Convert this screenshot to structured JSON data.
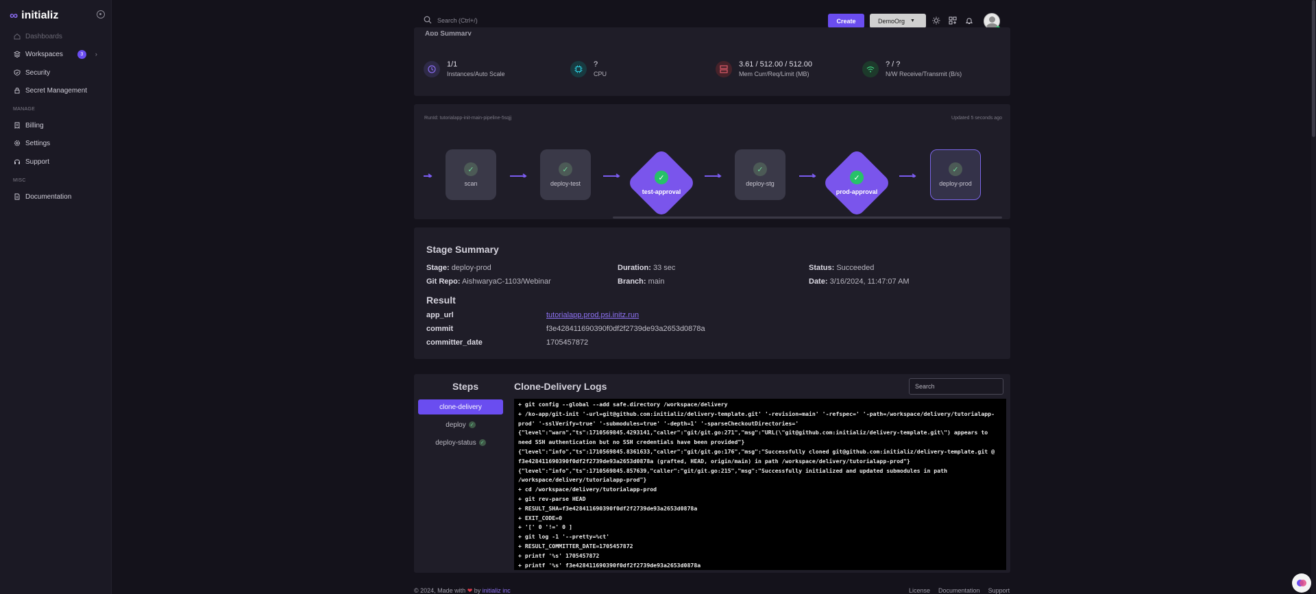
{
  "brand": {
    "name": "initializ"
  },
  "sidebar": {
    "items": [
      {
        "label": "Dashboards"
      },
      {
        "label": "Workspaces",
        "badge": "3"
      },
      {
        "label": "Security"
      },
      {
        "label": "Secret Management"
      }
    ],
    "manage_section": "MANAGE",
    "manage_items": [
      {
        "label": "Billing"
      },
      {
        "label": "Settings"
      },
      {
        "label": "Support"
      }
    ],
    "misc_section": "MISC",
    "misc_items": [
      {
        "label": "Documentation"
      }
    ]
  },
  "topbar": {
    "search_placeholder": "Search (Ctrl+/)",
    "create_label": "Create",
    "org_label": "DemoOrg"
  },
  "app_summary": {
    "title": "App Summary",
    "metrics": [
      {
        "value": "1/1",
        "label": "Instances/Auto Scale",
        "color": "#8a6cf1"
      },
      {
        "value": "?",
        "label": "CPU",
        "color": "#2bc4d6"
      },
      {
        "value": "3.61 / 512.00 / 512.00",
        "label": "Mem Curr/Req/Limit (MB)",
        "color": "#e05a6a"
      },
      {
        "value": "? / ?",
        "label": "N/W Receive/Transmit (B/s)",
        "color": "#3fcf7f"
      }
    ]
  },
  "pipeline": {
    "run_id": "RunId: tutorialapp-init-main-pipeline-5sqjj",
    "updated": "Updated 5 seconds ago",
    "stages": [
      {
        "name": "scan",
        "kind": "box"
      },
      {
        "name": "deploy-test",
        "kind": "box"
      },
      {
        "name": "test-approval",
        "kind": "diamond"
      },
      {
        "name": "deploy-stg",
        "kind": "box"
      },
      {
        "name": "prod-approval",
        "kind": "diamond"
      },
      {
        "name": "deploy-prod",
        "kind": "box"
      }
    ]
  },
  "stage_summary": {
    "title": "Stage Summary",
    "stage_label": "Stage:",
    "stage_value": "deploy-prod",
    "duration_label": "Duration:",
    "duration_value": "33 sec",
    "status_label": "Status:",
    "status_value": "Succeeded",
    "repo_label": "Git Repo:",
    "repo_value": "AishwaryaC-1103/Webinar",
    "branch_label": "Branch:",
    "branch_value": "main",
    "date_label": "Date:",
    "date_value": "3/16/2024, 11:47:07 AM",
    "result_title": "Result",
    "results": [
      {
        "key": "app_url",
        "value": "tutorialapp.prod.psi.initz.run"
      },
      {
        "key": "commit",
        "value": "f3e428411690390f0df2f2739de93a2653d0878a"
      },
      {
        "key": "committer_date",
        "value": "1705457872"
      }
    ]
  },
  "logs": {
    "steps_title": "Steps",
    "steps": [
      {
        "label": "clone-delivery"
      },
      {
        "label": "deploy"
      },
      {
        "label": "deploy-status"
      }
    ],
    "title": "Clone-Delivery Logs",
    "search_placeholder": "Search",
    "lines": [
      "+ git config --global --add safe.directory /workspace/delivery",
      "+ /ko-app/git-init '-url=git@github.com:initializ/delivery-template.git' '-revision=main' '-refspec=' '-path=/workspace/delivery/tutorialapp-prod' '-sslVerify=true' '-submodules=true' '-depth=1' '-sparseCheckoutDirectories='",
      "{\"level\":\"warn\",\"ts\":1710569845.4293141,\"caller\":\"git/git.go:271\",\"msg\":\"URL(\\\"git@github.com:initializ/delivery-template.git\\\") appears to need SSH authentication but no SSH credentials have been provided\"}",
      "{\"level\":\"info\",\"ts\":1710569845.8361633,\"caller\":\"git/git.go:176\",\"msg\":\"Successfully cloned git@github.com:initializ/delivery-template.git @ f3e428411690390f0df2f2739de93a2653d0878a (grafted, HEAD, origin/main) in path /workspace/delivery/tutorialapp-prod\"}",
      "{\"level\":\"info\",\"ts\":1710569845.857639,\"caller\":\"git/git.go:215\",\"msg\":\"Successfully initialized and updated submodules in path /workspace/delivery/tutorialapp-prod\"}",
      "+ cd /workspace/delivery/tutorialapp-prod",
      "+ git rev-parse HEAD",
      "+ RESULT_SHA=f3e428411690390f0df2f2739de93a2653d0878a",
      "+ EXIT_CODE=0",
      "+ '[' 0 '!=' 0 ]",
      "+ git log -1 '--pretty=%ct'",
      "+ RESULT_COMMITTER_DATE=1705457872",
      "+ printf '%s' 1705457872",
      "+ printf '%s' f3e428411690390f0df2f2739de93a2653d0878a"
    ]
  },
  "footer": {
    "left_prefix": "© 2024, Made with",
    "left_by": "by",
    "left_company": "initializ inc",
    "links": [
      "License",
      "Documentation",
      "Support"
    ]
  }
}
